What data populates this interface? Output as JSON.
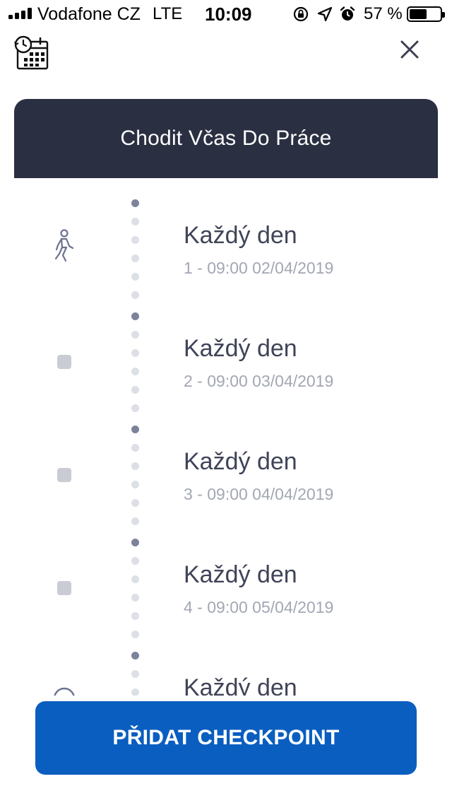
{
  "status_bar": {
    "carrier": "Vodafone CZ",
    "network": "LTE",
    "time": "10:09",
    "battery": "57 %",
    "battery_level": 0.57
  },
  "header": {
    "title": "Chodit Včas Do Práce"
  },
  "timeline": {
    "items": [
      {
        "title": "Každý den",
        "subtitle": "1 - 09:00 02/04/2019",
        "icon": "walking-person-icon"
      },
      {
        "title": "Každý den",
        "subtitle": "2 - 09:00 03/04/2019",
        "icon": "square-icon"
      },
      {
        "title": "Každý den",
        "subtitle": "3 - 09:00 04/04/2019",
        "icon": "square-icon"
      },
      {
        "title": "Každý den",
        "subtitle": "4 - 09:00 05/04/2019",
        "icon": "square-icon"
      },
      {
        "title": "Každý den",
        "subtitle": "",
        "icon": "circle-icon"
      }
    ]
  },
  "actions": {
    "add_checkpoint": "PŘIDAT CHECKPOINT"
  },
  "colors": {
    "header_bg": "#2b2f42",
    "primary_button": "#0a5ec0",
    "timeline_dot_major": "#7c839b",
    "timeline_dot_minor": "#dcdfe6"
  }
}
